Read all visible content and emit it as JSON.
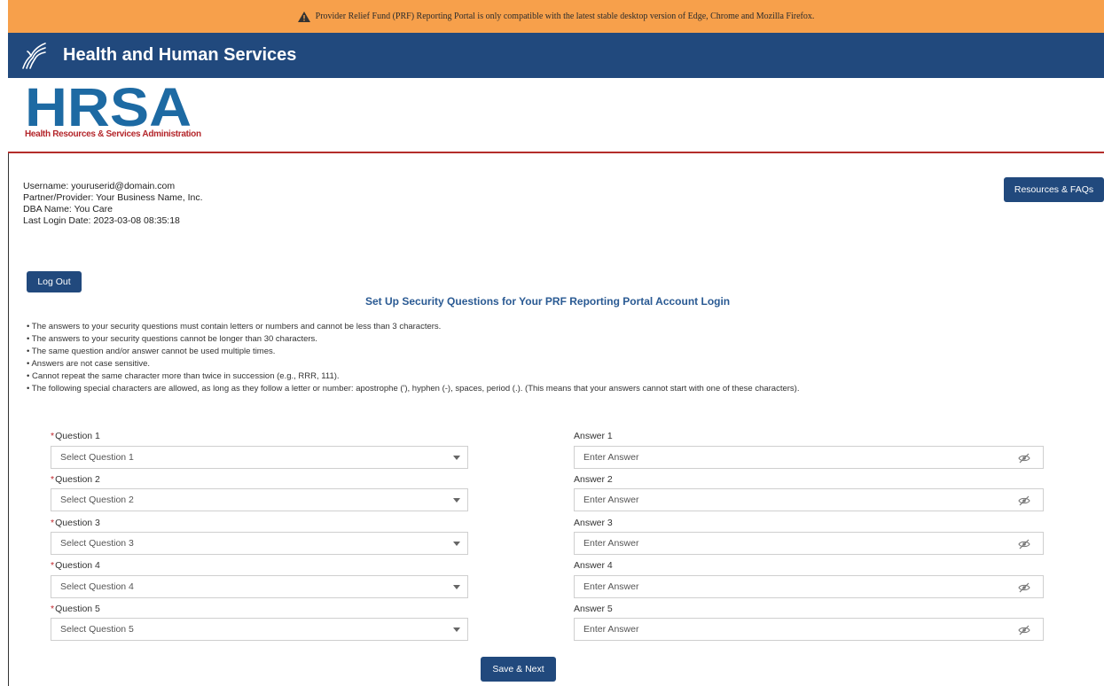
{
  "banner": {
    "text": "Provider Relief Fund (PRF) Reporting Portal is only compatible with the latest stable desktop version of Edge, Chrome and Mozilla Firefox."
  },
  "header": {
    "title": "Health and Human Services"
  },
  "logo": {
    "acronym": "HRSA",
    "subtitle": "Health Resources & Services Administration"
  },
  "user": {
    "username": "Username: youruserid@domain.com",
    "partner": "Partner/Provider: Your Business Name, Inc.",
    "dba": "DBA Name: You Care",
    "last_login": "Last Login Date: 2023-03-08 08:35:18"
  },
  "buttons": {
    "resources": "Resources & FAQs",
    "logout": "Log Out",
    "save": "Save & Next"
  },
  "page_title": "Set Up Security Questions for Your PRF Reporting Portal Account Login",
  "rules": [
    "The answers to your security questions must contain letters or numbers and cannot be less than 3 characters.",
    "The answers to your security questions cannot be longer than 30 characters.",
    "The same question and/or answer cannot be used multiple times.",
    "Answers are not case sensitive.",
    "Cannot repeat the same character more than twice in succession (e.g., RRR, 111).",
    "The following special characters are allowed, as long as they follow a letter or number: apostrophe ('), hyphen (-), spaces, period (.). (This means that your answers cannot start with one of these characters)."
  ],
  "questions": [
    {
      "label": "Question 1",
      "placeholder": "Select Question 1",
      "answer_label": "Answer 1",
      "answer_placeholder": "Enter Answer"
    },
    {
      "label": "Question 2",
      "placeholder": "Select Question 2",
      "answer_label": "Answer 2",
      "answer_placeholder": "Enter Answer"
    },
    {
      "label": "Question 3",
      "placeholder": "Select Question 3",
      "answer_label": "Answer 3",
      "answer_placeholder": "Enter Answer"
    },
    {
      "label": "Question 4",
      "placeholder": "Select Question 4",
      "answer_label": "Answer 4",
      "answer_placeholder": "Enter Answer"
    },
    {
      "label": "Question 5",
      "placeholder": "Select Question 5",
      "answer_label": "Answer 5",
      "answer_placeholder": "Enter Answer"
    }
  ],
  "required_marker": "*",
  "icons": {
    "warning": "warning-triangle-icon",
    "eagle": "hhs-eagle-icon",
    "caret": "chevron-down-icon",
    "eye": "eye-off-icon"
  },
  "colors": {
    "banner": "#f7a04b",
    "header": "#21497d",
    "accent": "#2a5a93",
    "required": "#c0262c",
    "logo": "#1d6aa3",
    "logo_sub": "#b4262b"
  }
}
